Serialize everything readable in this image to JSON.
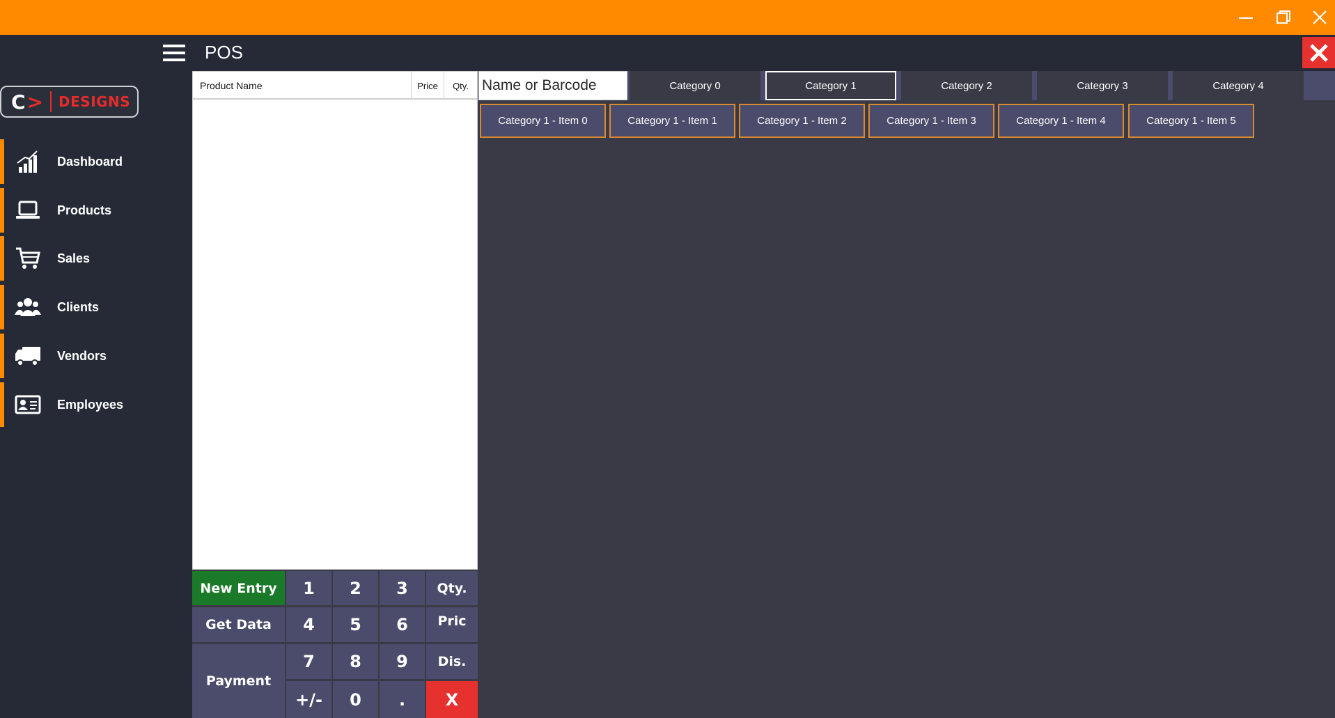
{
  "window": {
    "controls": [
      "minimize",
      "maximize",
      "close"
    ]
  },
  "header": {
    "title": "POS"
  },
  "logo": {
    "letter": "C",
    "arrow": ">",
    "text": "DESIGNS"
  },
  "sidebar": {
    "accent": "#ff8a00",
    "items": [
      {
        "label": "Dashboard",
        "icon": "chart-bars-icon"
      },
      {
        "label": "Products",
        "icon": "laptop-icon"
      },
      {
        "label": "Sales",
        "icon": "cart-icon"
      },
      {
        "label": "Clients",
        "icon": "users-icon"
      },
      {
        "label": "Vendors",
        "icon": "truck-icon"
      },
      {
        "label": "Employees",
        "icon": "id-card-icon"
      }
    ]
  },
  "order_table": {
    "columns": [
      "Product Name",
      "Price",
      "Qty."
    ],
    "rows": []
  },
  "keypad": {
    "new_entry": "New Entry",
    "get_data": "Get Data",
    "payment": "Payment",
    "digits": [
      "1",
      "2",
      "3",
      "4",
      "5",
      "6",
      "7",
      "8",
      "9",
      "+/-",
      "0",
      "."
    ],
    "qty": "Qty.",
    "price": "Pric",
    "discount": "Dis.",
    "clear": "X"
  },
  "search": {
    "placeholder": "Name or Barcode",
    "value": ""
  },
  "categories": {
    "tabs": [
      "Category 0",
      "Category 1",
      "Category 2",
      "Category 3",
      "Category 4"
    ],
    "selected": "Category 1"
  },
  "items": [
    "Category 1 - Item 0",
    "Category 1 - Item 1",
    "Category 1 - Item 2",
    "Category 1 - Item 3",
    "Category 1 - Item 4",
    "Category 1 - Item 5"
  ],
  "colors": {
    "title_bar": "#ff8a00",
    "sidebar": "#252a36",
    "content": "#3a3a47",
    "button": "#4b4b6b",
    "new_entry": "#1b7a2a",
    "danger": "#e6312e",
    "item_border": "#d98a2e"
  }
}
